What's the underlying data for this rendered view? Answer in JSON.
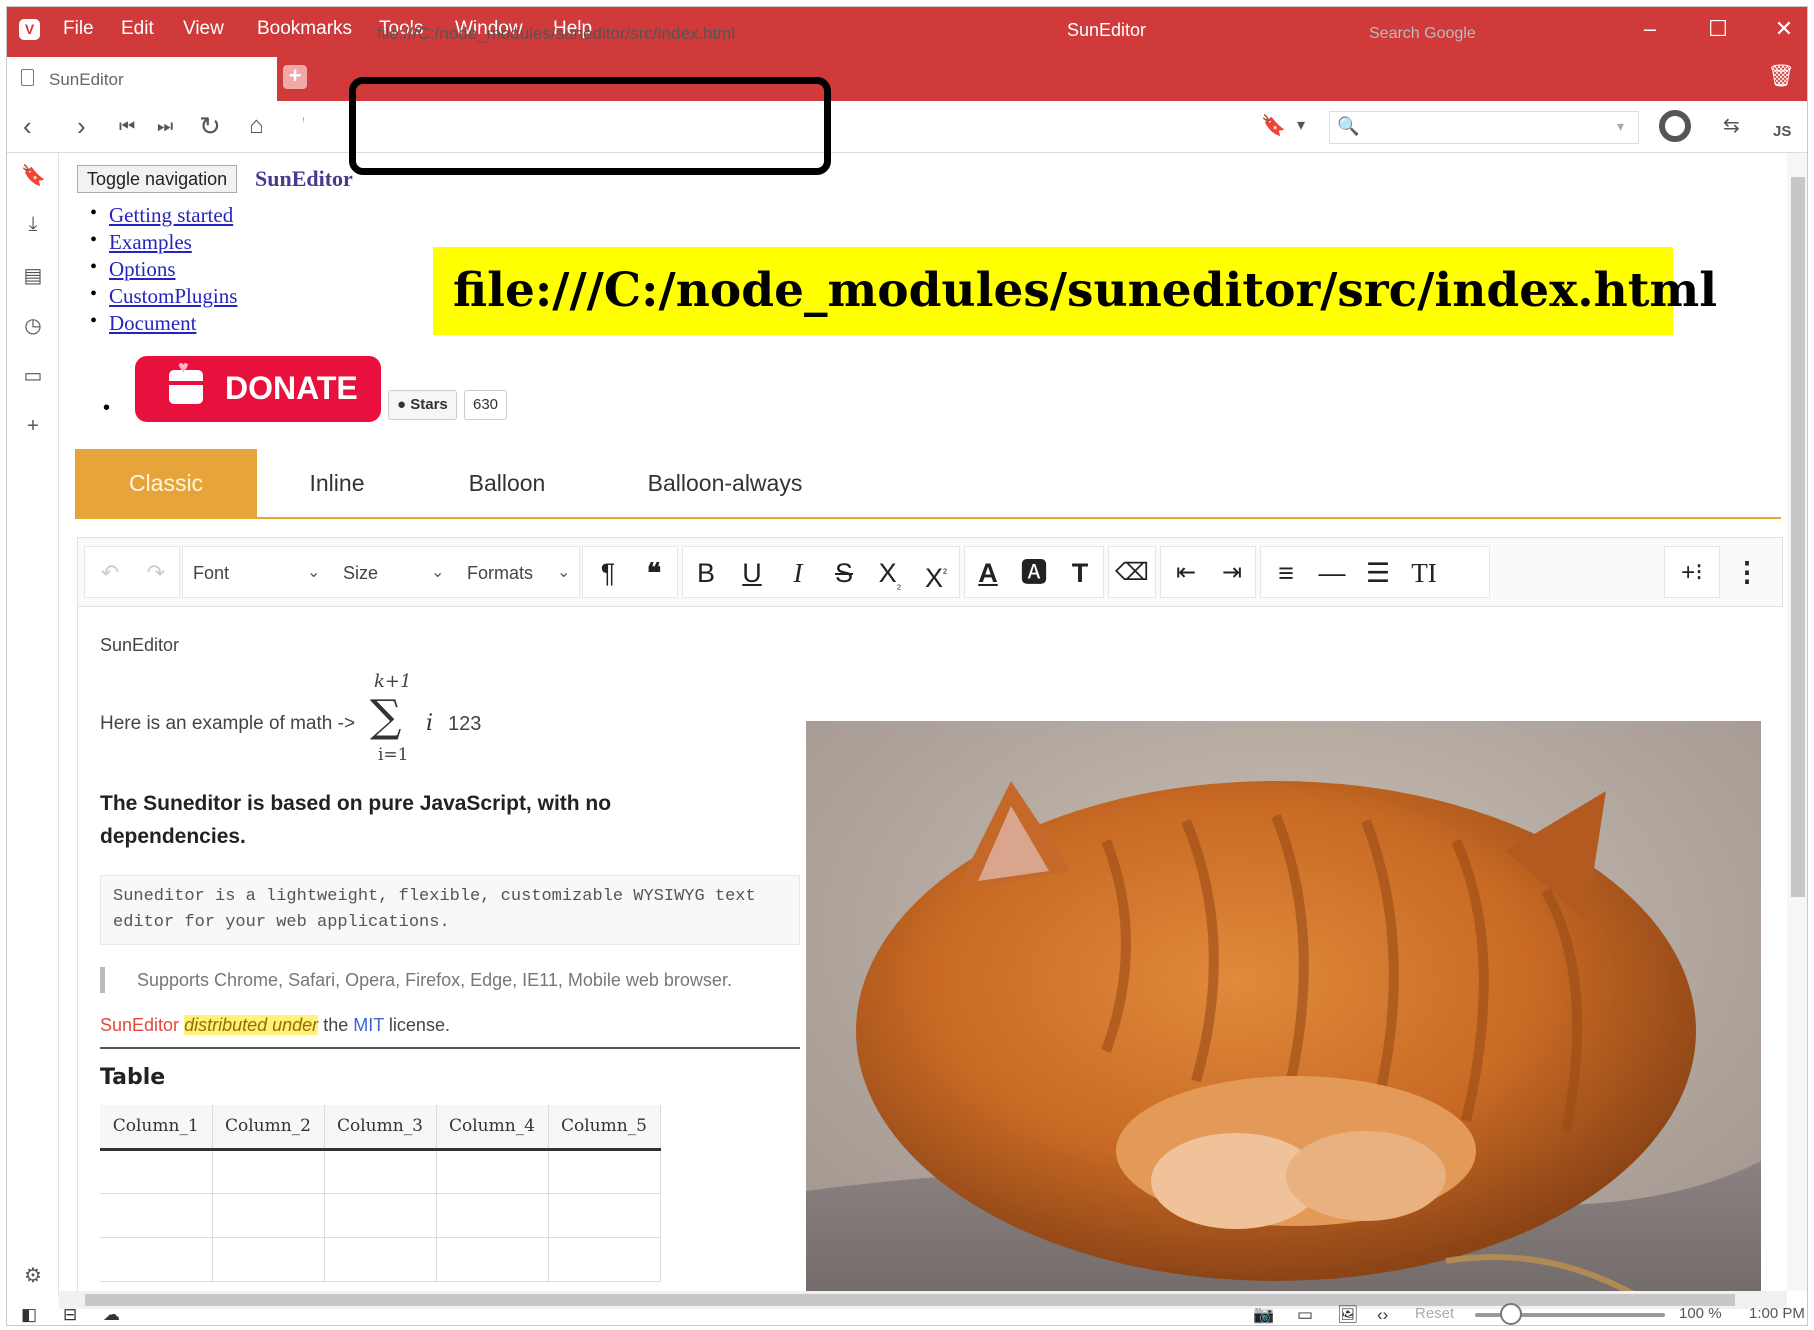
{
  "window": {
    "title": "SunEditor",
    "menu": [
      "File",
      "Edit",
      "View",
      "Bookmarks",
      "Tools",
      "Window",
      "Help"
    ]
  },
  "tab": {
    "title": "SunEditor"
  },
  "address": {
    "url": "file:///C:/node_modules/suneditor/src/index.html",
    "search_placeholder": "Search Google",
    "js_label": "JS"
  },
  "banner": {
    "text": "file:///C:/node_modules/suneditor/src/index.html"
  },
  "page": {
    "toggle_label": "Toggle navigation",
    "brand": "SunEditor",
    "nav": [
      "Getting started",
      "Examples",
      "Options",
      "CustomPlugins",
      "Document"
    ],
    "donate_label": "DONATE",
    "stars_label": "Stars",
    "stars_count": "630"
  },
  "editor_tabs": [
    "Classic",
    "Inline",
    "Balloon",
    "Balloon-always"
  ],
  "toolbar": {
    "font_label": "Font",
    "size_label": "Size",
    "formats_label": "Formats"
  },
  "content": {
    "label": "SunEditor",
    "math_prefix": "Here is an example of math ->",
    "math_sup": "k+1",
    "math_sub": "i=1",
    "math_var": "i",
    "math_suffix": "123",
    "bold_text": "The Suneditor is based on pure JavaScript, with no dependencies.",
    "code_text": "Suneditor is a lightweight, flexible, customizable WYSIWYG text editor for your web applications.",
    "quote_text": "Supports Chrome, Safari, Opera, Firefox, Edge, IE11, Mobile web browser.",
    "license_red": "SunEditor",
    "license_hl": "distributed under",
    "license_mid": "the",
    "license_blue": "MIT",
    "license_end": "license.",
    "table_title": "Table",
    "table_headers": [
      "Column_1",
      "Column_2",
      "Column_3",
      "Column_4",
      "Column_5"
    ]
  },
  "statusbar": {
    "reset_label": "Reset",
    "zoom": "100 %",
    "clock": "1:00 PM"
  },
  "colors": {
    "chrome_red": "#d03a3a",
    "tab_active": "#e7a43b",
    "donate": "#e8103c",
    "banner": "#ffff00"
  }
}
